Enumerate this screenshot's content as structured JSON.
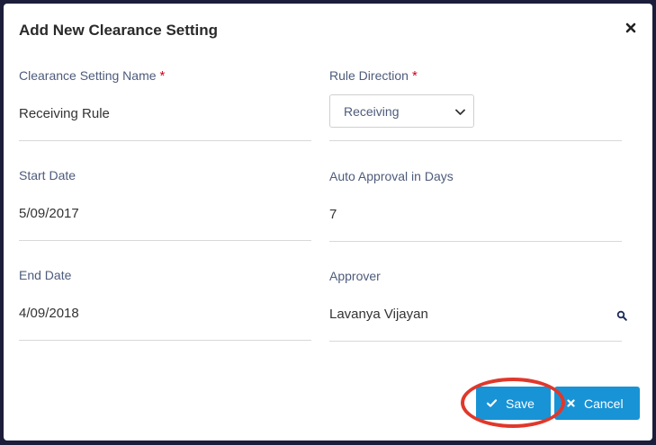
{
  "modal": {
    "title": "Add New Clearance Setting"
  },
  "fields": {
    "clearance_setting_name": {
      "label": "Clearance Setting Name",
      "required_mark": "*",
      "value": "Receiving Rule"
    },
    "rule_direction": {
      "label": "Rule Direction",
      "required_mark": "*",
      "selected": "Receiving"
    },
    "start_date": {
      "label": "Start Date",
      "value": "5/09/2017"
    },
    "auto_approval_days": {
      "label": "Auto Approval in Days",
      "value": "7"
    },
    "end_date": {
      "label": "End Date",
      "value": "4/09/2018"
    },
    "approver": {
      "label": "Approver",
      "value": "Lavanya Vijayan"
    }
  },
  "buttons": {
    "save_label": "Save",
    "cancel_label": "Cancel"
  },
  "icons": {
    "close": "close-icon",
    "dropdown": "chevron-down-icon",
    "search": "search-icon",
    "save": "check-icon",
    "cancel": "x-icon"
  },
  "colors": {
    "accent": "#1893d6",
    "required": "#d0021b",
    "annotation": "#e0382b",
    "label": "#4d5b7b"
  }
}
